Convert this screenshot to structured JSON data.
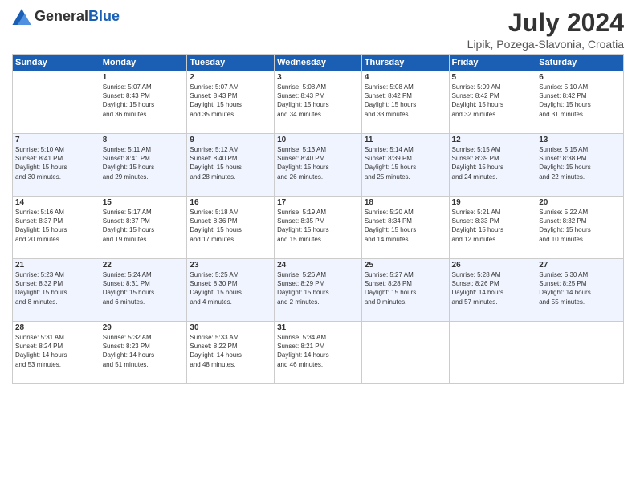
{
  "header": {
    "logo_general": "General",
    "logo_blue": "Blue",
    "title": "July 2024",
    "location": "Lipik, Pozega-Slavonia, Croatia"
  },
  "days_of_week": [
    "Sunday",
    "Monday",
    "Tuesday",
    "Wednesday",
    "Thursday",
    "Friday",
    "Saturday"
  ],
  "weeks": [
    [
      {
        "day": "",
        "info": ""
      },
      {
        "day": "1",
        "info": "Sunrise: 5:07 AM\nSunset: 8:43 PM\nDaylight: 15 hours\nand 36 minutes."
      },
      {
        "day": "2",
        "info": "Sunrise: 5:07 AM\nSunset: 8:43 PM\nDaylight: 15 hours\nand 35 minutes."
      },
      {
        "day": "3",
        "info": "Sunrise: 5:08 AM\nSunset: 8:43 PM\nDaylight: 15 hours\nand 34 minutes."
      },
      {
        "day": "4",
        "info": "Sunrise: 5:08 AM\nSunset: 8:42 PM\nDaylight: 15 hours\nand 33 minutes."
      },
      {
        "day": "5",
        "info": "Sunrise: 5:09 AM\nSunset: 8:42 PM\nDaylight: 15 hours\nand 32 minutes."
      },
      {
        "day": "6",
        "info": "Sunrise: 5:10 AM\nSunset: 8:42 PM\nDaylight: 15 hours\nand 31 minutes."
      }
    ],
    [
      {
        "day": "7",
        "info": "Sunrise: 5:10 AM\nSunset: 8:41 PM\nDaylight: 15 hours\nand 30 minutes."
      },
      {
        "day": "8",
        "info": "Sunrise: 5:11 AM\nSunset: 8:41 PM\nDaylight: 15 hours\nand 29 minutes."
      },
      {
        "day": "9",
        "info": "Sunrise: 5:12 AM\nSunset: 8:40 PM\nDaylight: 15 hours\nand 28 minutes."
      },
      {
        "day": "10",
        "info": "Sunrise: 5:13 AM\nSunset: 8:40 PM\nDaylight: 15 hours\nand 26 minutes."
      },
      {
        "day": "11",
        "info": "Sunrise: 5:14 AM\nSunset: 8:39 PM\nDaylight: 15 hours\nand 25 minutes."
      },
      {
        "day": "12",
        "info": "Sunrise: 5:15 AM\nSunset: 8:39 PM\nDaylight: 15 hours\nand 24 minutes."
      },
      {
        "day": "13",
        "info": "Sunrise: 5:15 AM\nSunset: 8:38 PM\nDaylight: 15 hours\nand 22 minutes."
      }
    ],
    [
      {
        "day": "14",
        "info": "Sunrise: 5:16 AM\nSunset: 8:37 PM\nDaylight: 15 hours\nand 20 minutes."
      },
      {
        "day": "15",
        "info": "Sunrise: 5:17 AM\nSunset: 8:37 PM\nDaylight: 15 hours\nand 19 minutes."
      },
      {
        "day": "16",
        "info": "Sunrise: 5:18 AM\nSunset: 8:36 PM\nDaylight: 15 hours\nand 17 minutes."
      },
      {
        "day": "17",
        "info": "Sunrise: 5:19 AM\nSunset: 8:35 PM\nDaylight: 15 hours\nand 15 minutes."
      },
      {
        "day": "18",
        "info": "Sunrise: 5:20 AM\nSunset: 8:34 PM\nDaylight: 15 hours\nand 14 minutes."
      },
      {
        "day": "19",
        "info": "Sunrise: 5:21 AM\nSunset: 8:33 PM\nDaylight: 15 hours\nand 12 minutes."
      },
      {
        "day": "20",
        "info": "Sunrise: 5:22 AM\nSunset: 8:32 PM\nDaylight: 15 hours\nand 10 minutes."
      }
    ],
    [
      {
        "day": "21",
        "info": "Sunrise: 5:23 AM\nSunset: 8:32 PM\nDaylight: 15 hours\nand 8 minutes."
      },
      {
        "day": "22",
        "info": "Sunrise: 5:24 AM\nSunset: 8:31 PM\nDaylight: 15 hours\nand 6 minutes."
      },
      {
        "day": "23",
        "info": "Sunrise: 5:25 AM\nSunset: 8:30 PM\nDaylight: 15 hours\nand 4 minutes."
      },
      {
        "day": "24",
        "info": "Sunrise: 5:26 AM\nSunset: 8:29 PM\nDaylight: 15 hours\nand 2 minutes."
      },
      {
        "day": "25",
        "info": "Sunrise: 5:27 AM\nSunset: 8:28 PM\nDaylight: 15 hours\nand 0 minutes."
      },
      {
        "day": "26",
        "info": "Sunrise: 5:28 AM\nSunset: 8:26 PM\nDaylight: 14 hours\nand 57 minutes."
      },
      {
        "day": "27",
        "info": "Sunrise: 5:30 AM\nSunset: 8:25 PM\nDaylight: 14 hours\nand 55 minutes."
      }
    ],
    [
      {
        "day": "28",
        "info": "Sunrise: 5:31 AM\nSunset: 8:24 PM\nDaylight: 14 hours\nand 53 minutes."
      },
      {
        "day": "29",
        "info": "Sunrise: 5:32 AM\nSunset: 8:23 PM\nDaylight: 14 hours\nand 51 minutes."
      },
      {
        "day": "30",
        "info": "Sunrise: 5:33 AM\nSunset: 8:22 PM\nDaylight: 14 hours\nand 48 minutes."
      },
      {
        "day": "31",
        "info": "Sunrise: 5:34 AM\nSunset: 8:21 PM\nDaylight: 14 hours\nand 46 minutes."
      },
      {
        "day": "",
        "info": ""
      },
      {
        "day": "",
        "info": ""
      },
      {
        "day": "",
        "info": ""
      }
    ]
  ]
}
